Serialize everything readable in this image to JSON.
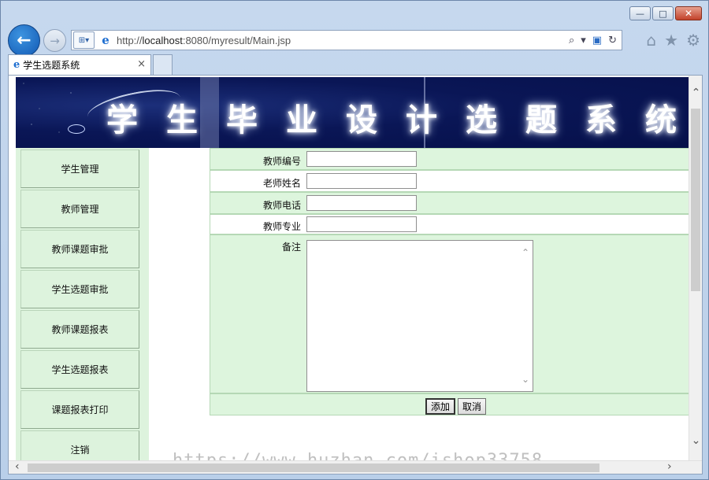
{
  "browser": {
    "url_prefix": "http://",
    "url_host": "localhost",
    "url_rest": ":8080/myresult/Main.jsp",
    "search_icon": "⌕",
    "tab_title": "学生选题系统",
    "tab_close": "×",
    "window_controls": {
      "minimize": "—",
      "maximize": "□",
      "close": "✕"
    },
    "nav": {
      "back": "←",
      "forward": "→"
    },
    "toolbar_icons": {
      "home": "⌂",
      "favorites": "★",
      "settings": "⚙"
    }
  },
  "banner": {
    "title": "学生毕业设计选题系统"
  },
  "menu": {
    "items": [
      {
        "label": "学生管理"
      },
      {
        "label": "教师管理"
      },
      {
        "label": "教师课题审批"
      },
      {
        "label": "学生选题审批"
      },
      {
        "label": "教师课题报表"
      },
      {
        "label": "学生选题报表"
      },
      {
        "label": "课题报表打印"
      },
      {
        "label": "注销"
      }
    ]
  },
  "form": {
    "fields": [
      {
        "label": "教师编号",
        "value": ""
      },
      {
        "label": "老师姓名",
        "value": ""
      },
      {
        "label": "教师电话",
        "value": ""
      },
      {
        "label": "教师专业",
        "value": ""
      }
    ],
    "remark_label": "备注",
    "remark_value": "",
    "submit_label": "添加",
    "cancel_label": "取消"
  },
  "watermark": "https://www.huzhan.com/ishop33758",
  "colors": {
    "banner_bg": "#0a1656",
    "menu_bg": "#ddf3dd",
    "row_green": "#ddf5dd",
    "accent_blue": "#1f6fd1"
  }
}
